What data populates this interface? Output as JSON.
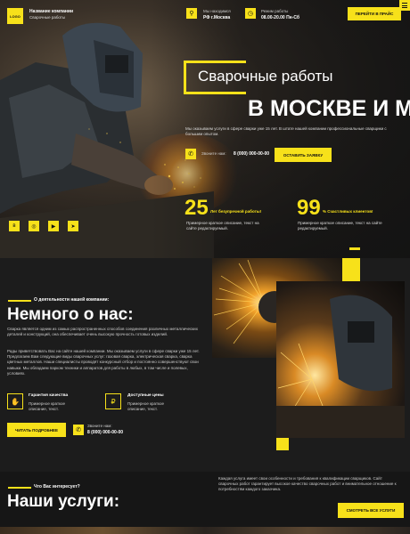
{
  "header": {
    "logo": "LOGO",
    "company_name": "Название компании",
    "company_sub": "Сварочные работы",
    "location_label": "Мы находимся",
    "location_value": "РФ г.Москва",
    "hours_label": "Режим работы",
    "hours_value": "08.00-20.00 Пн-Сб",
    "cta": "ПЕРЕЙТИ В ПРАЙС"
  },
  "hero": {
    "title_line1": "Сварочные работы",
    "title_line2": "В МОСКВЕ И МО",
    "description": "Мы оказываем услуги в сфере сварки уже 15 лет. В штате нашей компании профессиональные сварщики с большим опытом.",
    "call_label": "Звоните нам:",
    "phone": "8 (000) 000-00-00",
    "cta": "ОСТАВИТЬ ЗАЯВКУ"
  },
  "stats": [
    {
      "number": "25",
      "title": "Лет безупречной работы!",
      "text": "Примерное краткое описание, текст на сайте редактируемый."
    },
    {
      "number": "99",
      "title": "% Счастливых клиентов!",
      "text": "Примерное краткое описание, текст на сайте редактируемый."
    }
  ],
  "social": [
    {
      "icon": "vk-icon",
      "glyph": "в"
    },
    {
      "icon": "instagram-icon",
      "glyph": "◎"
    },
    {
      "icon": "youtube-icon",
      "glyph": "▶"
    },
    {
      "icon": "telegram-icon",
      "glyph": "➤"
    }
  ],
  "about": {
    "eyebrow": "О деятельности нашей компании:",
    "title": "Немного о нас:",
    "para1": "Сварка является одним из самых распространенных способов соединения различных металлических деталей и конструкций, она обеспечивает очень высокую прочность готовых изделий.",
    "para2": "Рады приветствовать Вас на сайте нашей компании. Мы оказываем услуги в сфере сварки уже 15 лет. Предлагаем Вам следующие виды сварочных услуг: газовая сварка, электрическая сварка, сварка цветных металлов. Наши специалисты проводят конкурсный отбор и постоянно совершенствуют свои навыки. Мы обладаем парком техники и аппаратов для работы в любых, в том числе и полевых, условиях.",
    "features": [
      {
        "icon": "handshake-icon",
        "title": "Гарантия качества",
        "text": "Примерное краткое описание, текст."
      },
      {
        "icon": "price-icon",
        "title": "Доступные цены",
        "text": "Примерное краткое описание, текст."
      }
    ],
    "cta": "ЧИТАТЬ ПОДРОБНЕЕ",
    "call_label": "Звоните нам:",
    "phone": "8 (000) 000-00-00"
  },
  "services": {
    "eyebrow": "Что Вас интересует?",
    "title": "Наши услуги:",
    "description": "Каждая услуга имеет свои особенности и требования к квалификации сварщиков. Сайт сварочных работ гарантирует высокое качество сварочных работ и внимательное отношение к потребностям каждого заказчика.",
    "cta": "СМОТРЕТЬ ВСЕ УСЛУГИ"
  },
  "colors": {
    "accent": "#f7e11a",
    "background": "#1c1c1c"
  }
}
